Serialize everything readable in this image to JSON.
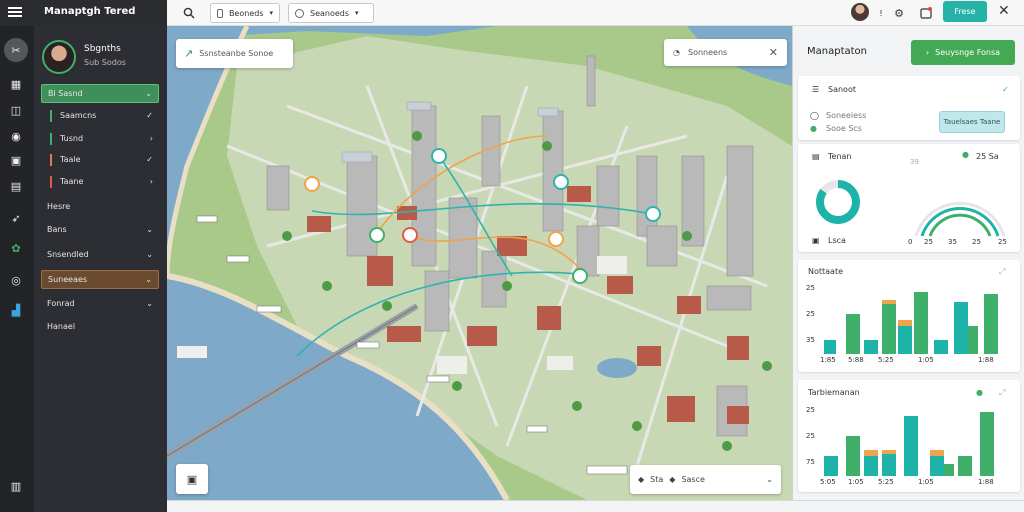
{
  "app": {
    "brand": "Manaptgh Tered"
  },
  "topbar": {
    "dropdown_1": "Beoneds",
    "dropdown_2": "Seanoeds",
    "cta_label": "Frese"
  },
  "profile": {
    "name": "Sbgnths",
    "sub": "Sub Sodos"
  },
  "menu": [
    {
      "label": "Bl Sasnd",
      "style": "green"
    },
    {
      "label": "Saamcns",
      "bar": "#3fb06a"
    },
    {
      "label": "Tusnd",
      "bar": "#3fb06a"
    },
    {
      "label": "Taale",
      "bar": "#e07b4a"
    },
    {
      "label": "Taane",
      "bar": "#e05a4a"
    },
    {
      "label": "Hesre"
    },
    {
      "label": "Bans"
    },
    {
      "label": "Snsendled"
    },
    {
      "label": "Suneeaes",
      "style": "brown"
    },
    {
      "label": "Fonrad"
    },
    {
      "label": "Hanael"
    }
  ],
  "map": {
    "search_label": "Ssnsteanbe Sonoe",
    "filter_label": "Sonneens",
    "legend_a": "Sta",
    "legend_b": "Sasce"
  },
  "panel": {
    "title": "Manaptaton",
    "button_label": "Seuysnge Fonsa",
    "card1": {
      "row1": "Sanoot",
      "row2_a": "Soneeiess",
      "row2_b": "Sooe Scs",
      "pill": "Tauelsaes Taane"
    },
    "card2": {
      "title": "Tenan",
      "right_label": "25 Sa",
      "right_small": "39",
      "gauge_vals": [
        "0",
        "25",
        "35",
        "25"
      ],
      "bottom": "Lsca",
      "ticks": [
        "25",
        "35",
        "25"
      ]
    },
    "card3": {
      "title": "Nottaate",
      "ticks_y": [
        "25",
        "25",
        "35"
      ],
      "ticks_x": [
        "1:85",
        "5:88",
        "5:25",
        "1:05",
        "1:88"
      ]
    },
    "card4": {
      "title": "Tarbiemanan",
      "ticks_y": [
        "25",
        "25",
        "75"
      ],
      "ticks_x": [
        "5:05",
        "1:05",
        "5:25",
        "1:05",
        "1:88"
      ]
    }
  },
  "colors": {
    "accent": "#44a954",
    "teal": "#25b3a9",
    "sidebar": "#2d2e33"
  }
}
